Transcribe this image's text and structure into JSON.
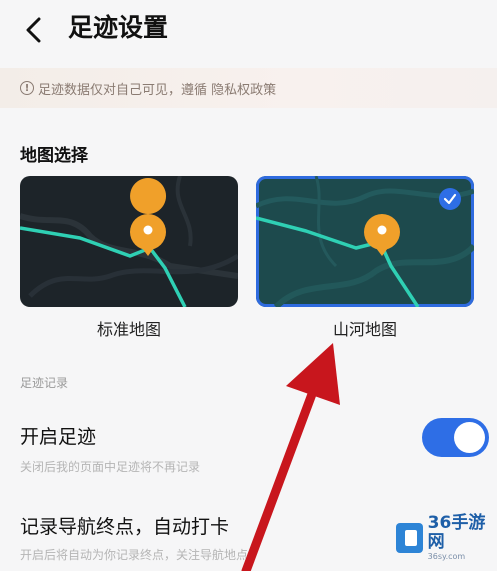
{
  "header": {
    "title": "足迹设置"
  },
  "notice": {
    "text": "足迹数据仅对自己可见，遵循 隐私权政策"
  },
  "map_section": {
    "title": "地图选择",
    "options": [
      {
        "label": "标准地图",
        "selected": false
      },
      {
        "label": "山河地图",
        "selected": true
      }
    ]
  },
  "record_section": {
    "title": "足迹记录",
    "rows": [
      {
        "title": "开启足迹",
        "subtitle": "关闭后我的页面中足迹将不再记录",
        "enabled": true
      },
      {
        "title": "记录导航终点，自动打卡",
        "subtitle": "开启后将自动为你记录终点，关注导航地点"
      }
    ]
  },
  "watermark": {
    "brand": "36手游网",
    "url": "36sy.com"
  },
  "colors": {
    "accent": "#2e6ee6",
    "route": "#2fd0b4",
    "pin": "#f0a02a"
  }
}
